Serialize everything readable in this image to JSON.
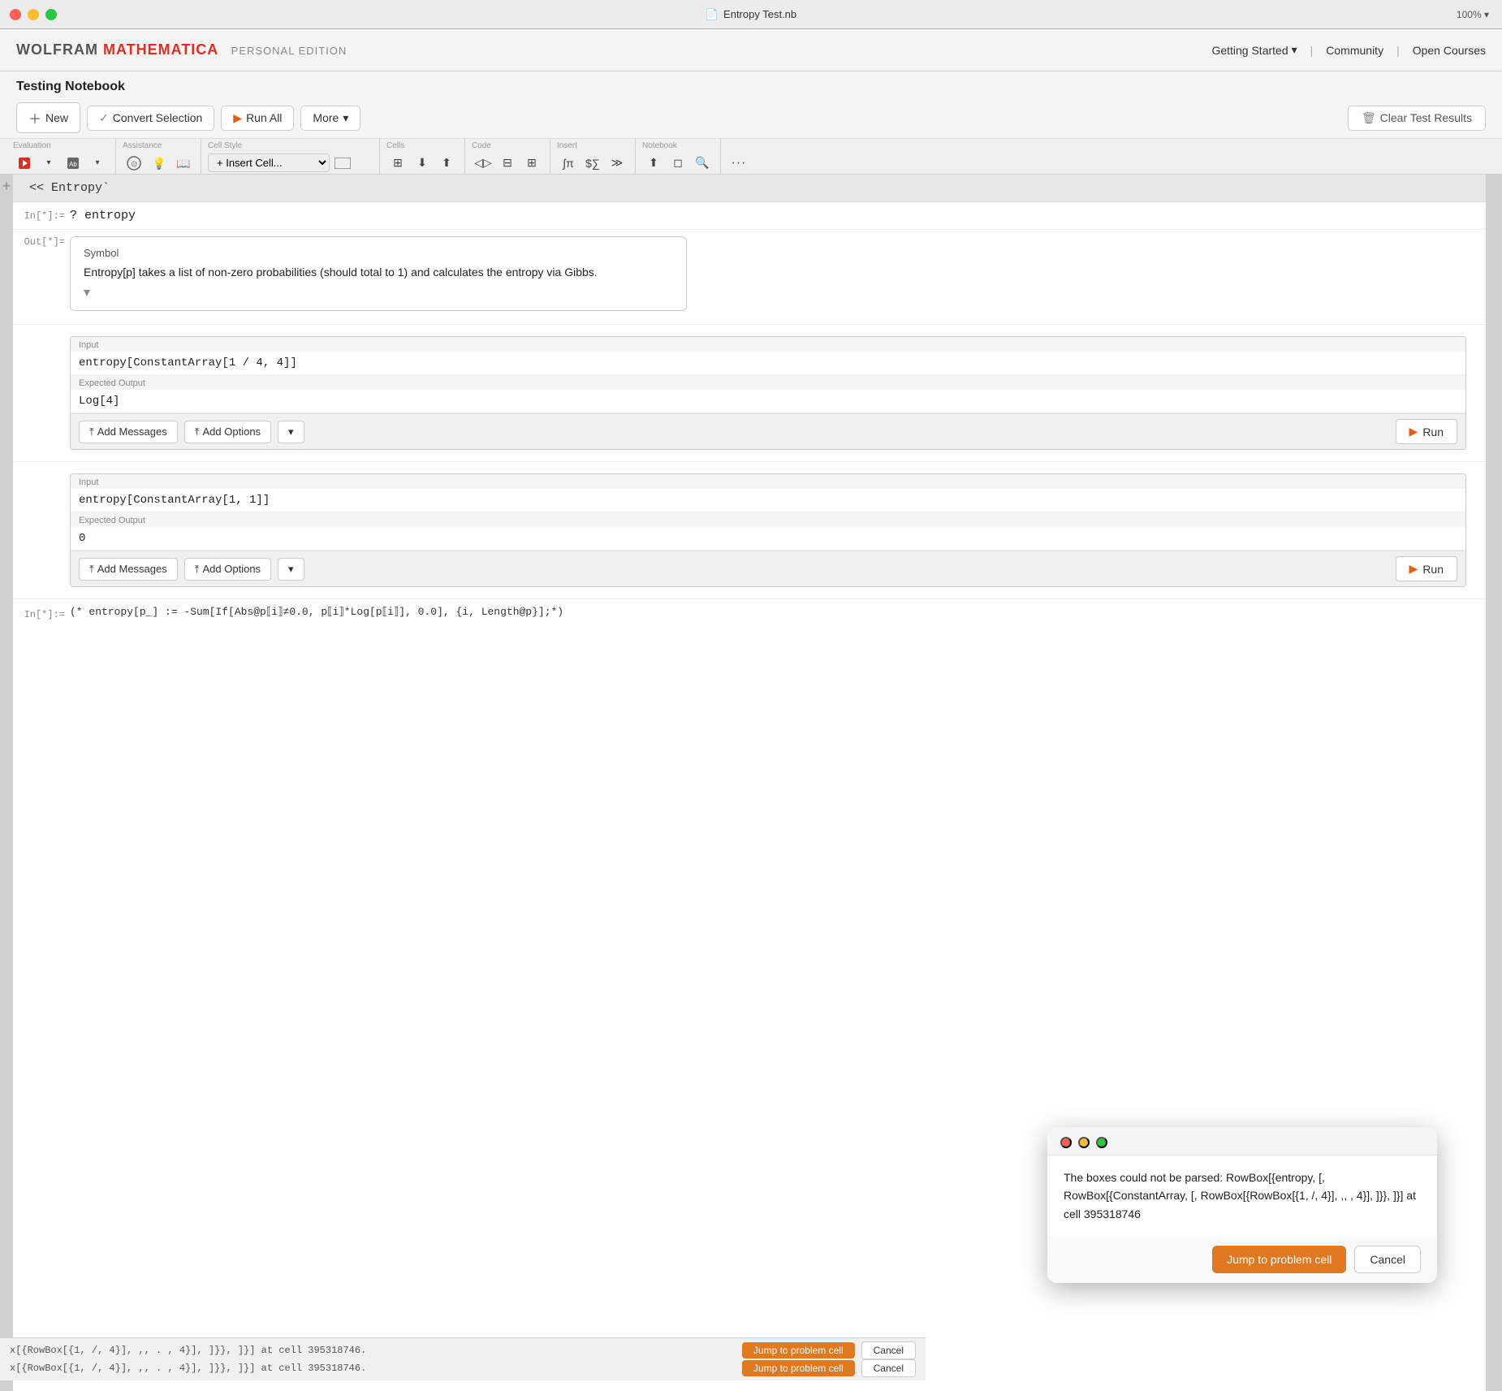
{
  "window": {
    "title": "Entropy Test.nb",
    "zoom": "100%"
  },
  "window_controls": {
    "red": "close",
    "yellow": "minimize",
    "green": "maximize"
  },
  "brand": {
    "wolfram": "WOLFRAM",
    "math": "MATHEMATICA",
    "sep": "|",
    "edition": "PERSONAL EDITION"
  },
  "menu_right": {
    "getting_started": "Getting Started",
    "sep1": "|",
    "community": "Community",
    "sep2": "|",
    "open_courses": "Open Courses"
  },
  "notebook": {
    "title": "Testing Notebook",
    "toolbar": {
      "new_label": "New",
      "convert_label": "Convert Selection",
      "run_all_label": "Run All",
      "more_label": "More",
      "clear_label": "Clear Test Results"
    }
  },
  "toolbar2": {
    "evaluation_label": "Evaluation",
    "assistance_label": "Assistance",
    "cell_style_label": "Cell Style",
    "insert_cell_placeholder": "Insert Cell...",
    "cells_label": "Cells",
    "code_label": "Code",
    "insert_label": "Insert",
    "notebook_label": "Notebook"
  },
  "cells": {
    "package_cell": "<< Entropy`",
    "query_label": "In[*]:=",
    "query_code": "? entropy",
    "out_label": "Out[*]=",
    "symbol_title": "Symbol",
    "symbol_desc": "Entropy[p] takes a list of non-zero probabilities (should total to 1) and calculates the entropy via Gibbs.",
    "test1": {
      "input_label": "Input",
      "input_code": "entropy[ConstantArray[1 / 4, 4]]",
      "expected_label": "Expected Output",
      "expected_code": "Log[4]",
      "add_messages": "Add Messages",
      "add_options": "Add Options",
      "run": "Run"
    },
    "test2": {
      "input_label": "Input",
      "input_code": "entropy[ConstantArray[1, 1]]",
      "expected_label": "Expected Output",
      "expected_code": "0",
      "add_messages": "Add Messages",
      "add_options": "Add Options",
      "run": "Run"
    },
    "code_label": "In[*]:=",
    "code_line": "(* entropy[p_] := -Sum[If[Abs@p⟦i⟧≠0.0, p⟦i⟧*Log[p⟦i⟧], 0.0], {i, Length@p}];*)"
  },
  "dialog": {
    "title_bar": [
      "red",
      "yellow",
      "green"
    ],
    "message": "The boxes could not be parsed: RowBox[{entropy, [, RowBox[{ConstantArray, [, RowBox[{RowBox[{1, /, 4}], ,,  , 4}], ]}}, ]}] at cell 395318746",
    "jump_btn": "Jump to problem cell",
    "cancel_btn": "Cancel"
  },
  "bottom_bar": {
    "row1_text": "x[{RowBox[{1, /, 4}], ,, . , 4}], ]}}, ]}] at cell 395318746.",
    "row2_text": "x[{RowBox[{1, /, 4}], ,, . , 4}], ]}}, ]}] at cell 395318746.",
    "jump_btn": "Jump to problem cell",
    "cancel_btn": "Cancel"
  }
}
